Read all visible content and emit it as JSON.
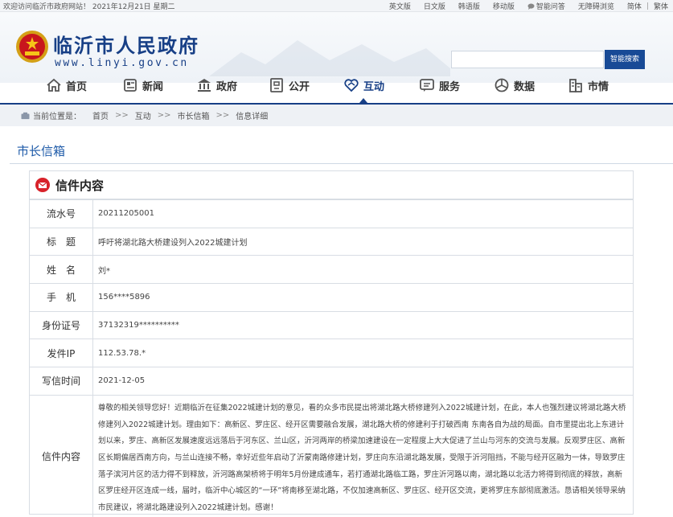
{
  "topbar": {
    "welcome": "欢迎访问临沂市政府网站！ 2021年12月21日 星期二",
    "links": [
      "英文版",
      "日文版",
      "韩语版",
      "移动版",
      "智能问答",
      "无障碍浏览",
      "简体",
      "繁体"
    ]
  },
  "header": {
    "title": "临沂市人民政府",
    "url": "www.linyi.gov.cn",
    "search_placeholder": "",
    "search_button": "智能搜索"
  },
  "nav": [
    {
      "label": "首页",
      "icon": "home-icon"
    },
    {
      "label": "新闻",
      "icon": "news-icon"
    },
    {
      "label": "政府",
      "icon": "government-icon"
    },
    {
      "label": "公开",
      "icon": "disclosure-icon"
    },
    {
      "label": "互动",
      "icon": "interaction-icon",
      "active": true
    },
    {
      "label": "服务",
      "icon": "service-icon"
    },
    {
      "label": "数据",
      "icon": "data-icon"
    },
    {
      "label": "市情",
      "icon": "city-info-icon"
    }
  ],
  "breadcrumb": {
    "prefix": "当前位置是：",
    "items": [
      "首页",
      "互动",
      "市长信箱",
      "信息详细"
    ],
    "separator": ">>"
  },
  "section_title": "市长信箱",
  "letter": {
    "heading": "信件内容",
    "rows": [
      {
        "label": "流水号",
        "value": "20211205001"
      },
      {
        "label": "标　题",
        "value": "呼吁将湖北路大桥建设列入2022城建计划"
      },
      {
        "label": "姓　名",
        "value": "刘*"
      },
      {
        "label": "手　机",
        "value": "156****5896"
      },
      {
        "label": "身份证号",
        "value": "37132319**********"
      },
      {
        "label": "发件IP",
        "value": "112.53.78.*"
      },
      {
        "label": "写信时间",
        "value": "2021-12-05"
      }
    ],
    "content_label": "信件内容",
    "content": "尊敬的相关领导您好！近期临沂在征集2022城建计划的意见，看的众多市民提出将湖北路大桥修建列入2022城建计划，在此，本人也强烈建议将湖北路大桥修建列入2022城建计划。理由如下：高新区、罗庄区、经开区需要融合发展，湖北路大桥的修建利于打破西南 东南各自为战的局面。自市里提出北上东进计划以来，罗庄、高新区发展速度远远落后于河东区、兰山区，沂河两岸的桥梁加速建设在一定程度上大大促进了兰山与河东的交流与发展。反观罗庄区、高新区长期偏居西南方向，与兰山连接不畅，幸好近些年启动了沂蒙南路修建计划，罗庄向东沿湖北路发展，受限于沂河阻挡，不能与经开区融为一体，导致罗庄落子滨河片区的活力得不到释放，沂河路高架桥将于明年5月份建成通车，若打通湖北路临工路，罗庄沂河路以南，湖北路以北活力将得到彻底的释放，高新区罗庄经开区连成一线，届时，临沂中心城区的“一环”将南移至湖北路，不仅加速高新区、罗庄区、经开区交流，更将罗庄东部彻底激活。恳请相关领导采纳市民建议，将湖北路建设列入2022城建计划。感谢！"
  }
}
